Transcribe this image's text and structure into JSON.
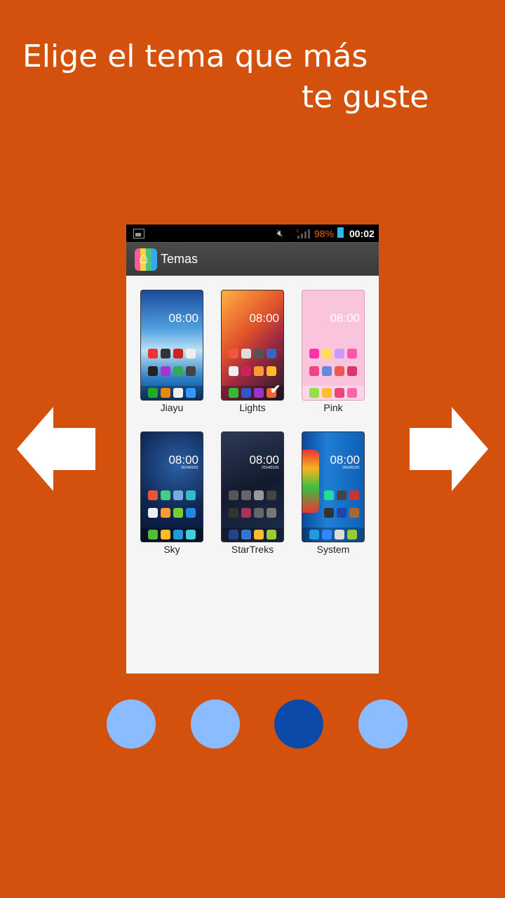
{
  "headline": {
    "line1": "Elige el tema que más",
    "line2": "te guste"
  },
  "phone": {
    "statusbar": {
      "battery": "98%",
      "time": "00:02"
    },
    "appbar": {
      "title": "Temas"
    },
    "themes": [
      {
        "name": "Jiayu",
        "time": "08:00",
        "date": "",
        "selected": false
      },
      {
        "name": "Lights",
        "time": "08:00",
        "date": "",
        "selected": true
      },
      {
        "name": "Pink",
        "time": "08:00",
        "date": "",
        "selected": false
      },
      {
        "name": "Sky",
        "time": "08:00",
        "date": "2014/01/01",
        "selected": false
      },
      {
        "name": "StarTreks",
        "time": "08:00",
        "date": "2014/01/01",
        "selected": false
      },
      {
        "name": "System",
        "time": "08:00",
        "date": "2014/01/01",
        "selected": false
      }
    ]
  },
  "pager": {
    "count": 4,
    "active_index": 2
  },
  "colors": {
    "background": "#d4500d",
    "dot_inactive": "#8bbcff",
    "dot_active": "#0b4aa8",
    "battery_text": "#e8671c"
  }
}
